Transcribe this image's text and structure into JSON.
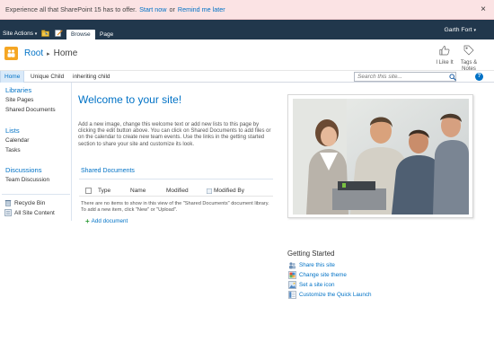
{
  "status_bar": {
    "message": "Experience all that SharePoint 15 has to offer.",
    "start_now": "Start now",
    "or": "or",
    "remind_later": "Remind me later",
    "close": "×"
  },
  "ribbon": {
    "site_actions": "Site Actions",
    "tabs": [
      "Browse",
      "Page"
    ],
    "user": "Garth Fort"
  },
  "title_area": {
    "breadcrumb_root": "Root",
    "breadcrumb_current": "Home",
    "i_like_it": "I Like It",
    "tags_notes_line1": "Tags &",
    "tags_notes_line2": "Notes"
  },
  "top_nav": {
    "items": [
      "Home",
      "Unique Child",
      "inheriting child"
    ],
    "search_placeholder": "Search this site...",
    "help": "?"
  },
  "left_nav": {
    "libraries_heading": "Libraries",
    "libraries": [
      "Site Pages",
      "Shared Documents"
    ],
    "lists_heading": "Lists",
    "lists": [
      "Calendar",
      "Tasks"
    ],
    "discussions_heading": "Discussions",
    "discussions": [
      "Team Discussion"
    ],
    "recycle_bin": "Recycle Bin",
    "all_site_content": "All Site Content"
  },
  "main": {
    "welcome_title": "Welcome to your site!",
    "welcome_text": "Add a new image, change this welcome text or add new lists to this page by clicking the edit button above. You can click on Shared Documents to add files or on the calendar to create new team events. Use the links in the getting started section to share your site and customize its look.",
    "shared_docs": {
      "title": "Shared Documents",
      "columns": [
        "Type",
        "Name",
        "Modified",
        "Modified By"
      ],
      "empty_message": "There are no items to show in this view of the \"Shared Documents\" document library. To add a new item, click \"New\" or \"Upload\".",
      "add_document": "Add document"
    }
  },
  "getting_started": {
    "title": "Getting Started",
    "items": [
      {
        "label": "Share this site",
        "icon": "share-icon"
      },
      {
        "label": "Change site theme",
        "icon": "theme-icon"
      },
      {
        "label": "Set a site icon",
        "icon": "site-icon-icon"
      },
      {
        "label": "Customize the Quick Launch",
        "icon": "quick-launch-icon"
      }
    ]
  },
  "colors": {
    "ribbon": "#21374c",
    "accent": "#0072c6",
    "status_bar": "#fbe3e4",
    "logo": "#f5a623"
  }
}
